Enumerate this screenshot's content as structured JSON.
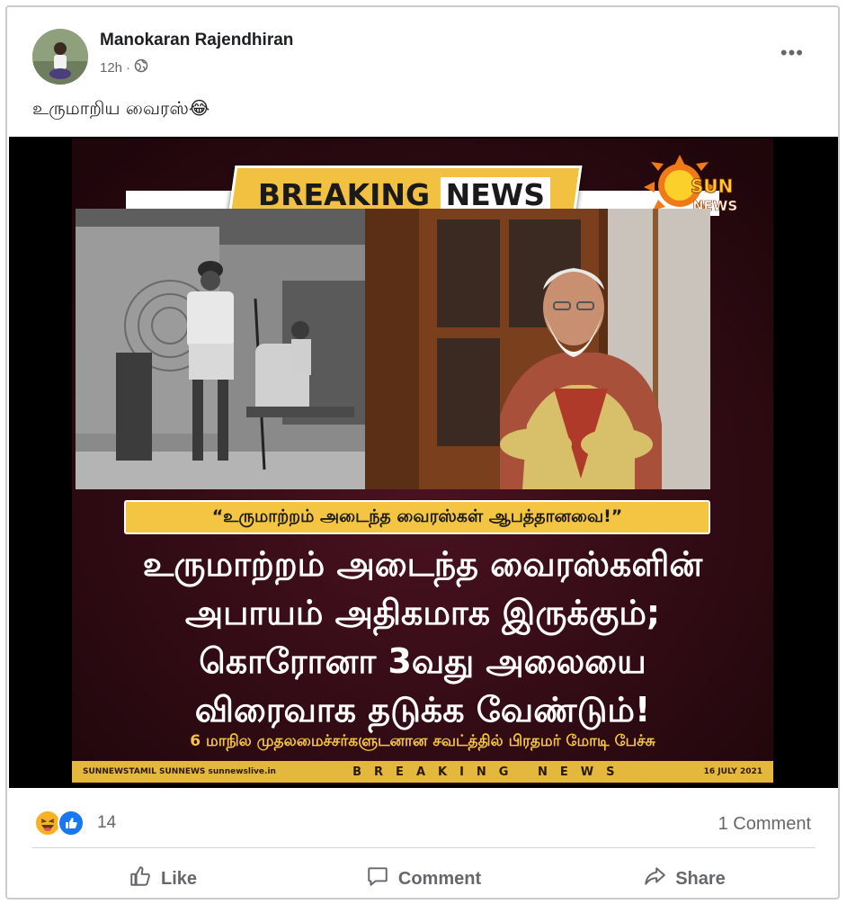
{
  "post": {
    "author": "Manokaran Rajendhiran",
    "time": "12h",
    "separator": "·",
    "caption": "உருமாறிய வைரஸ்😂",
    "more_label": "•••"
  },
  "poster": {
    "breaking": "BREAKING",
    "news": "NEWS",
    "channel_top": "SUN",
    "channel_bottom": "NEWS",
    "quote": "“உருமாற்றம் அடைந்த வைரஸ்கள் ஆபத்தானவை!”",
    "headline_lines": [
      "உருமாற்றம் அடைந்த வைரஸ்களின்",
      "அபாயம் அதிகமாக இருக்கும்;",
      "கொரோனா 3வது அலையை",
      "விரைவாக தடுக்க வேண்டும்!"
    ],
    "subline": "6 மாநில முதலமைச்சர்களுடனான சவட்த்தில் பிரதமர் மோடி பேச்சு",
    "footer_socials": "SUNNEWSTAMIL  SUNNEWS  sunnewslive.in",
    "footer_mid": "BREAKING NEWS",
    "footer_date": "16 JULY 2021"
  },
  "stats": {
    "reaction_count": "14",
    "comments": "1 Comment"
  },
  "actions": {
    "like": "Like",
    "comment": "Comment",
    "share": "Share"
  },
  "colors": {
    "brand_blue": "#1877f2",
    "poster_gold": "#f4c542",
    "poster_bg": "#2c0c12"
  }
}
